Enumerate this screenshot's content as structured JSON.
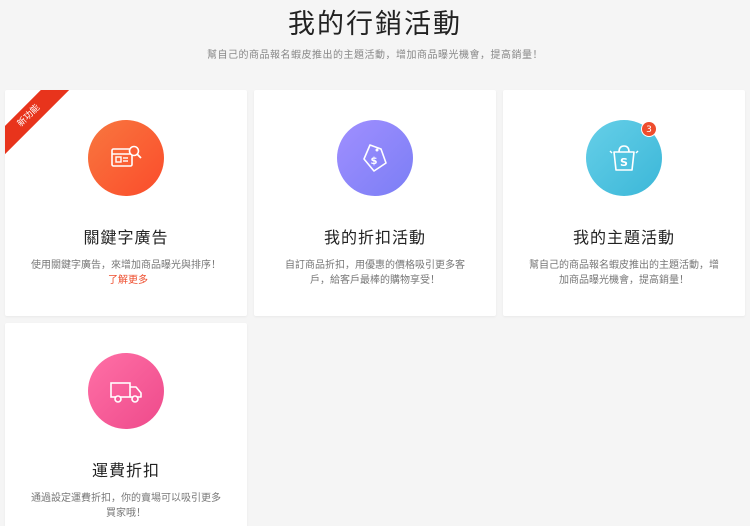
{
  "header": {
    "title": "我的行銷活動",
    "subtitle": "幫自己的商品報名蝦皮推出的主題活動，增加商品曝光機會，提高銷量！"
  },
  "cards": [
    {
      "title": "關鍵字廣告",
      "desc": "使用關鍵字廣告，來增加商品曝光與排序！",
      "link": "了解更多",
      "ribbon": "新功能",
      "icon": "keyword-ad-icon",
      "gradient": [
        "#f8713c",
        "#fb4f2c"
      ]
    },
    {
      "title": "我的折扣活動",
      "desc": "自訂商品折扣，用優惠的價格吸引更多客戶，給客戶最棒的購物享受！",
      "icon": "price-tag-icon",
      "gradient": [
        "#9a8bff",
        "#7a7cf6"
      ]
    },
    {
      "title": "我的主題活動",
      "desc": "幫自己的商品報名蝦皮推出的主題活動，增加商品曝光機會，提高銷量！",
      "badge": "3",
      "icon": "shopping-bag-icon",
      "gradient": [
        "#5fcbe6",
        "#3fb9d9"
      ]
    },
    {
      "title": "運費折扣",
      "desc": "通過設定運費折扣，你的賣場可以吸引更多買家哦！",
      "icon": "delivery-truck-icon",
      "gradient": [
        "#ff6aa2",
        "#f04c8d"
      ]
    }
  ]
}
